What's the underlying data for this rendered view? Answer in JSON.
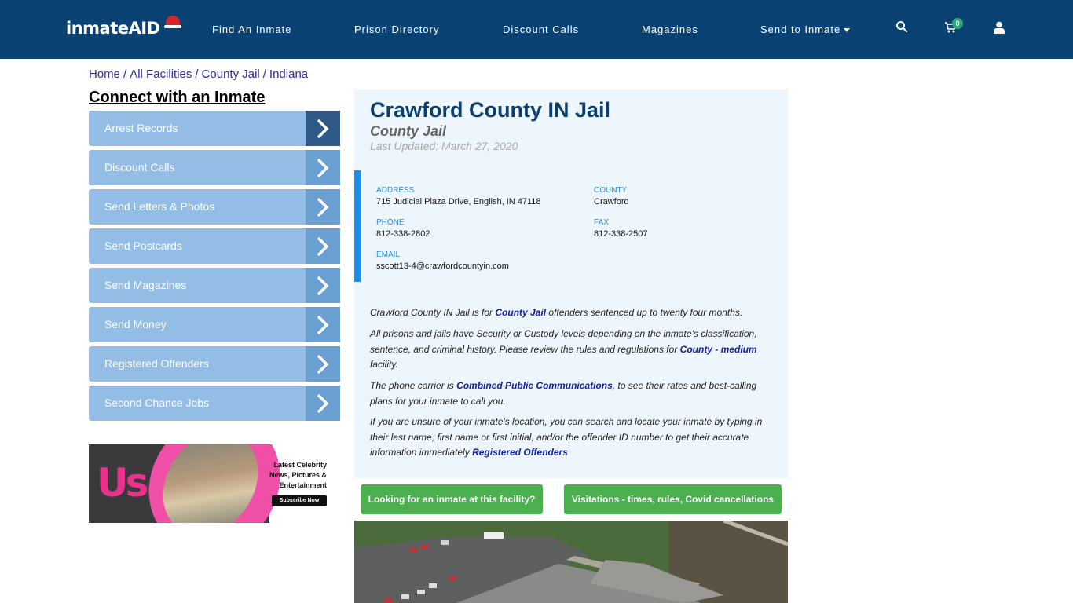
{
  "header": {
    "logo_text": "inmate",
    "logo_accent": "AID",
    "nav": [
      {
        "label": "Find An Inmate"
      },
      {
        "label": "Prison Directory"
      },
      {
        "label": "Discount Calls"
      },
      {
        "label": "Magazines"
      },
      {
        "label": "Send to Inmate",
        "has_dropdown": true
      }
    ],
    "icons": [
      "search-icon",
      "cart-icon",
      "user-icon"
    ],
    "cart_count": "0"
  },
  "breadcrumb": [
    {
      "label": "Home"
    },
    {
      "label": "All Facilities"
    },
    {
      "label": "County Jail"
    },
    {
      "label": "Indiana"
    }
  ],
  "sidebar": {
    "title": "Connect with an Inmate",
    "items": [
      {
        "label": "Arrest Records"
      },
      {
        "label": "Discount Calls"
      },
      {
        "label": "Send Letters & Photos"
      },
      {
        "label": "Send Postcards"
      },
      {
        "label": "Send Magazines"
      },
      {
        "label": "Send Money"
      },
      {
        "label": "Registered Offenders"
      },
      {
        "label": "Second Chance Jobs"
      }
    ],
    "ad": {
      "brand": "Us",
      "tagline_1": "Latest Celebrity",
      "tagline_2": "News, Pictures &",
      "tagline_3": "Entertainment",
      "cta": "Subscribe Now"
    }
  },
  "facility": {
    "name": "Crawford County IN Jail",
    "type": "County Jail",
    "last_updated": "Last Updated: March 27, 2020",
    "address_label": "ADDRESS",
    "address": "715 Judicial Plaza Drive, English, IN 47118",
    "county_label": "COUNTY",
    "county": "Crawford",
    "phone_label": "PHONE",
    "phone": "812-338-2802",
    "fax_label": "FAX",
    "fax": "812-338-2507",
    "email_label": "EMAIL",
    "email": "sscott13-4@crawfordcountyin.com"
  },
  "description": {
    "p1_a": "Crawford County IN Jail is for ",
    "p1_link": "County Jail",
    "p1_b": " offenders sentenced up to twenty four months.",
    "p2_a": "All prisons and jails have Security or Custody levels depending on the inmate's classification, sentence, and criminal history. Please review the rules and regulations for ",
    "p2_link": "County - medium",
    "p2_b": " facility.",
    "p3_a": "The phone carrier is ",
    "p3_link": "Combined Public Communications",
    "p3_b": ", to see their rates and best-calling plans for your inmate to call you.",
    "p4_a": "If you are unsure of your inmate's location, you can search and locate your inmate by typing in their last name, first name or first initial, and/or the offender ID number to get their accurate information immediately ",
    "p4_link": "Registered Offenders"
  },
  "buttons": {
    "find_inmate": "Looking for an inmate at this facility?",
    "visitations": "Visitations - times, rules, Covid cancellations"
  },
  "colors": {
    "header_bg": "#0b4274",
    "menu_bg": "#94bde6",
    "accent_blue": "#1a8fe9",
    "button_green": "#4caf50",
    "title_blue": "#0c3e6e"
  }
}
